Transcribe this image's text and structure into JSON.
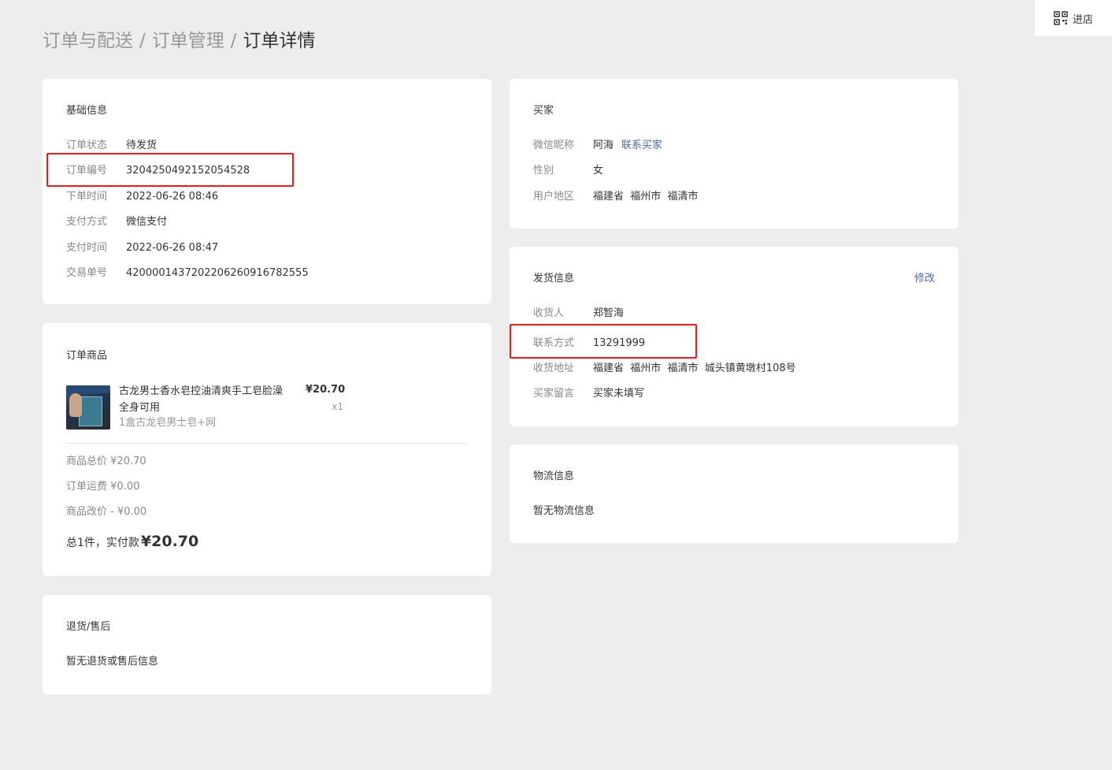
{
  "store_button": {
    "label": "进店",
    "icon": "qr-code-icon"
  },
  "breadcrumb": {
    "level1": "订单与配送",
    "level2": "订单管理",
    "current": "订单详情",
    "separator": "/"
  },
  "basic_info": {
    "title": "基础信息",
    "rows": [
      {
        "label": "订单状态",
        "value": "待发货"
      },
      {
        "label": "订单编号",
        "value": "3204250492152054528"
      },
      {
        "label": "下单时间",
        "value": "2022-06-26 08:46"
      },
      {
        "label": "支付方式",
        "value": "微信支付"
      },
      {
        "label": "支付时间",
        "value": "2022-06-26 08:47"
      },
      {
        "label": "交易单号",
        "value": "4200001437202206260916782555"
      }
    ]
  },
  "order_goods": {
    "title": "订单商品",
    "product": {
      "name": "古龙男士香水皂控油清爽手工皂脸澡全身可用",
      "sku": "1盒古龙皂男士皂+网",
      "price": "¥20.70",
      "qty": "x1"
    },
    "summary": [
      {
        "label": "商品总价",
        "value": "¥20.70"
      },
      {
        "label": "订单运费",
        "value": "¥0.00"
      },
      {
        "label": "商品改价",
        "value": "- ¥0.00"
      }
    ],
    "total_prefix": "总1件，实付款",
    "total_amount": "¥20.70"
  },
  "refund": {
    "title": "退货/售后",
    "empty_text": "暂无退货或售后信息"
  },
  "buyer": {
    "title": "买家",
    "nickname_label": "微信昵称",
    "nickname": "阿海",
    "contact_link": "联系买家",
    "gender_label": "性别",
    "gender": "女",
    "region_label": "用户地区",
    "region": "福建省  福州市  福清市"
  },
  "shipping": {
    "title": "发货信息",
    "edit_label": "修改",
    "rows": [
      {
        "label": "收货人",
        "value": "郑智海"
      },
      {
        "label": "联系方式",
        "value": "13291999"
      },
      {
        "label": "收货地址",
        "value": "福建省  福州市  福清市  城头镇黄墩村108号"
      },
      {
        "label": "买家留言",
        "value": "买家未填写"
      }
    ]
  },
  "logistics": {
    "title": "物流信息",
    "empty_text": "暂无物流信息"
  },
  "colors": {
    "highlight": "#e02020",
    "link": "#4a6aa5",
    "background": "#ededed"
  }
}
